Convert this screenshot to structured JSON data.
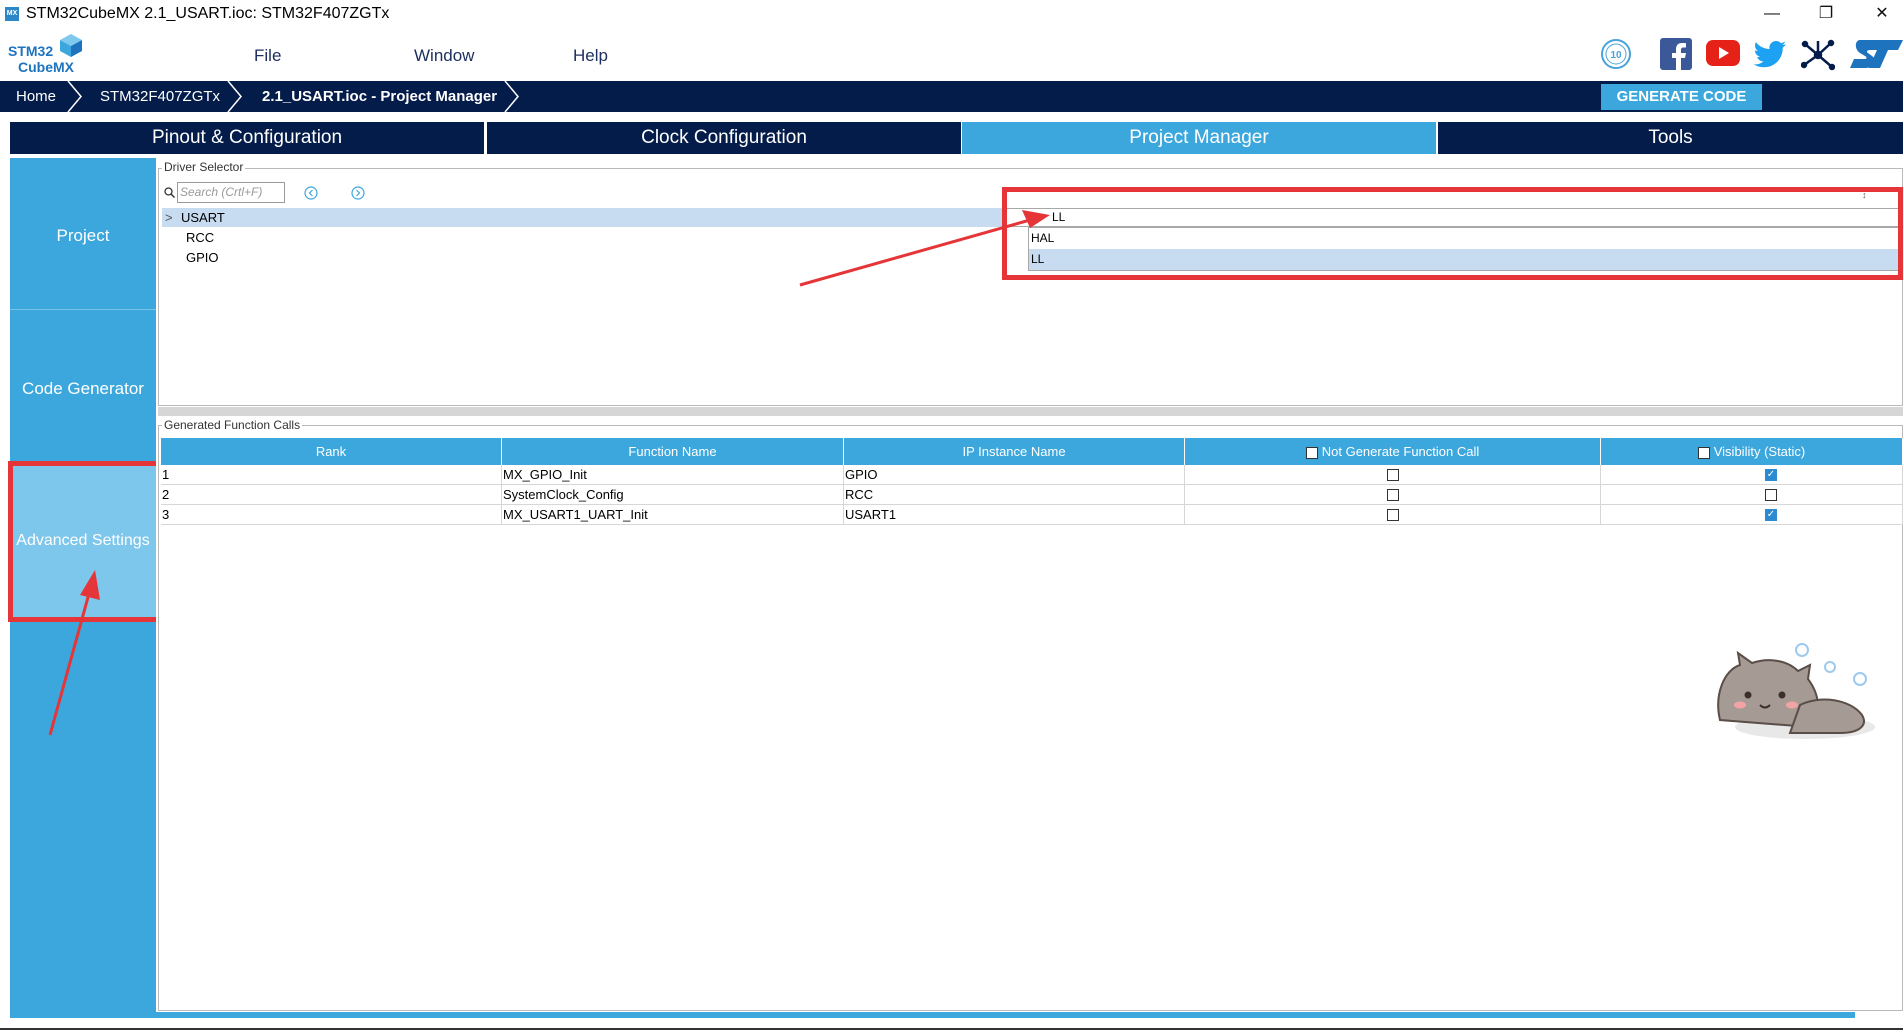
{
  "window": {
    "title": "STM32CubeMX 2.1_USART.ioc: STM32F407ZGTx",
    "app_icon": "MX",
    "minimize": "—",
    "maximize": "❐",
    "close": "✕"
  },
  "menu": {
    "logo_line1": "STM32",
    "logo_line2": "CubeMX",
    "items": [
      "File",
      "Window",
      "Help"
    ],
    "social_icons": [
      "10-year-badge-icon",
      "facebook-icon",
      "youtube-icon",
      "twitter-icon",
      "network-icon",
      "st-logo-icon"
    ]
  },
  "breadcrumb": {
    "items": [
      "Home",
      "STM32F407ZGTx",
      "2.1_USART.ioc - Project Manager"
    ],
    "generate_code": "GENERATE CODE"
  },
  "tabs": [
    "Pinout & Configuration",
    "Clock Configuration",
    "Project Manager",
    "Tools"
  ],
  "active_tab": "Project Manager",
  "sidebar": {
    "items": [
      "Project",
      "Code Generator",
      "Advanced Settings"
    ],
    "selected": "Advanced Settings"
  },
  "driver_selector": {
    "legend": "Driver Selector",
    "search_placeholder": "Search (Crtl+F)",
    "tree": [
      "USART",
      "RCC",
      "GPIO"
    ],
    "selected_value": "LL",
    "options": [
      "HAL",
      "LL"
    ]
  },
  "function_calls": {
    "legend": "Generated Function Calls",
    "columns": [
      "Rank",
      "Function Name",
      "IP Instance Name",
      "Not Generate Function Call",
      "Visibility (Static)"
    ],
    "rows": [
      {
        "rank": "1",
        "function": "MX_GPIO_Init",
        "ip": "GPIO",
        "not_generate": false,
        "visibility": true
      },
      {
        "rank": "2",
        "function": "SystemClock_Config",
        "ip": "RCC",
        "not_generate": false,
        "visibility": false
      },
      {
        "rank": "3",
        "function": "MX_USART1_UART_Init",
        "ip": "USART1",
        "not_generate": false,
        "visibility": true
      }
    ]
  },
  "colors": {
    "navy": "#041c4a",
    "accent": "#3ca7dd",
    "highlight": "#e63538"
  }
}
